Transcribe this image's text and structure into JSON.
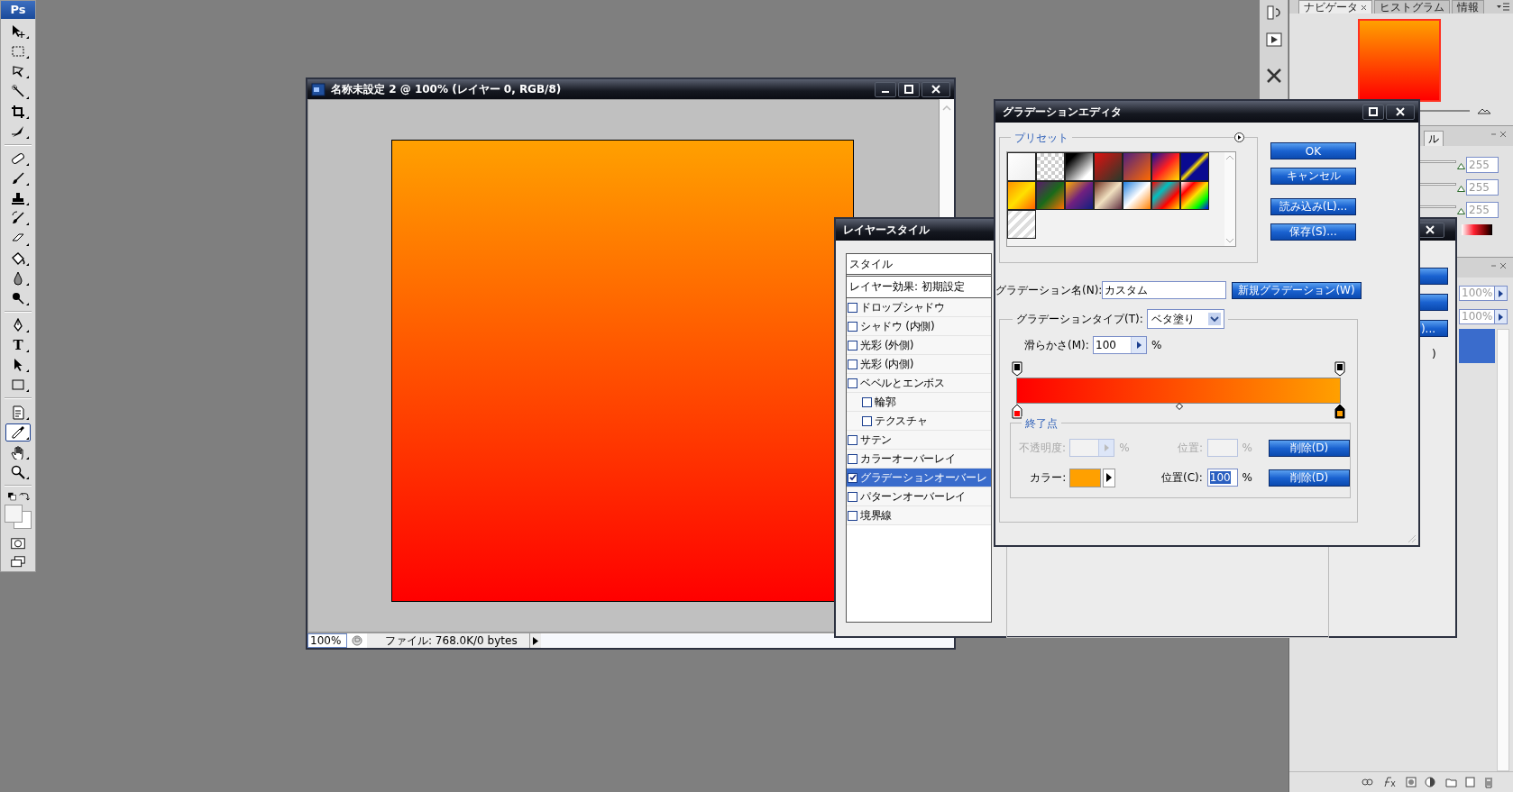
{
  "toolbar": {
    "logo": "Ps",
    "tool_groups": [
      [
        {
          "kind": "move",
          "selected": false
        },
        {
          "kind": "marquee",
          "selected": false
        },
        {
          "kind": "lasso",
          "selected": false
        },
        {
          "kind": "wand",
          "selected": false
        },
        {
          "kind": "crop",
          "selected": false
        },
        {
          "kind": "slice",
          "selected": false
        }
      ],
      [
        {
          "kind": "healing",
          "selected": false
        },
        {
          "kind": "brush",
          "selected": false
        },
        {
          "kind": "stamp",
          "selected": false
        },
        {
          "kind": "history",
          "selected": false
        },
        {
          "kind": "eraser",
          "selected": false
        },
        {
          "kind": "bucket",
          "selected": false
        },
        {
          "kind": "drop",
          "selected": false
        },
        {
          "kind": "dodge",
          "selected": false
        }
      ],
      [
        {
          "kind": "pen",
          "selected": false
        },
        {
          "kind": "type",
          "glyph": "T",
          "selected": false
        },
        {
          "kind": "arrow",
          "selected": false
        },
        {
          "kind": "shape",
          "selected": false
        }
      ],
      [
        {
          "kind": "notes",
          "selected": false
        },
        {
          "kind": "eyedropper",
          "selected": true
        },
        {
          "kind": "hand",
          "selected": false
        },
        {
          "kind": "zoom",
          "selected": false
        }
      ]
    ]
  },
  "document": {
    "title": "名称未設定 2 @ 100% (レイヤー 0, RGB/8)",
    "zoom": "100%",
    "status": "ファイル: 768.0K/0 bytes"
  },
  "layer_style": {
    "title": "レイヤースタイル",
    "header": "スタイル",
    "blend_default": "レイヤー効果: 初期設定",
    "effects": [
      {
        "label": "ドロップシャドウ",
        "checked": false,
        "selected": false
      },
      {
        "label": "シャドウ (内側)",
        "checked": false,
        "selected": false
      },
      {
        "label": "光彩 (外側)",
        "checked": false,
        "selected": false
      },
      {
        "label": "光彩 (内側)",
        "checked": false,
        "selected": false
      },
      {
        "label": "ベベルとエンボス",
        "checked": false,
        "selected": false,
        "children": [
          {
            "label": "輪郭",
            "checked": false,
            "selected": false
          },
          {
            "label": "テクスチャ",
            "checked": false,
            "selected": false
          }
        ]
      },
      {
        "label": "サテン",
        "checked": false,
        "selected": false
      },
      {
        "label": "カラーオーバーレイ",
        "checked": false,
        "selected": false
      },
      {
        "label": "グラデーションオーバーレ",
        "checked": true,
        "selected": true
      },
      {
        "label": "パターンオーバーレイ",
        "checked": false,
        "selected": false
      },
      {
        "label": "境界線",
        "checked": false,
        "selected": false
      }
    ],
    "side_button": ")...",
    "side_text": ")"
  },
  "gradient_editor": {
    "title": "グラデーションエディタ",
    "presets_label": "プリセット",
    "buttons": [
      "OK",
      "キャンセル",
      "読み込み(L)...",
      "保存(S)..."
    ],
    "name_label": "グラデーション名(N):",
    "name_value": "カスタム",
    "new_button": "新規グラデーション(W)",
    "type_label": "グラデーションタイプ(T):",
    "type_value": "ベタ塗り",
    "smooth_label": "滑らかさ(M):",
    "smooth_value": "100",
    "smooth_unit": "%",
    "color_stops": [
      {
        "color": "#ff0000",
        "selected": false
      },
      {
        "color": "#ffa000",
        "selected": true
      }
    ],
    "stops_label": "終了点",
    "opacity_row": {
      "label": "不透明度:",
      "unit": "%",
      "position_label": "位置:",
      "position_unit": "%",
      "delete": "削除(D)",
      "disabled": true
    },
    "color_row": {
      "label": "カラー:",
      "color": "#ffa000",
      "position_label": "位置(C):",
      "position_value": "100",
      "position_unit": "%",
      "delete": "削除(D)",
      "disabled": false
    }
  },
  "panels": {
    "navigator_tabs": [
      {
        "label": "ナビゲータ",
        "selected": true
      },
      {
        "label": "ヒストグラム",
        "selected": false
      },
      {
        "label": "情報",
        "selected": false
      }
    ],
    "color_tab": "ル",
    "color_channels": [
      {
        "level": 1,
        "value": "255"
      },
      {
        "level": 1,
        "value": "255"
      },
      {
        "level": 1,
        "value": "255"
      }
    ],
    "layer_values": [
      "100%",
      "100%"
    ]
  }
}
